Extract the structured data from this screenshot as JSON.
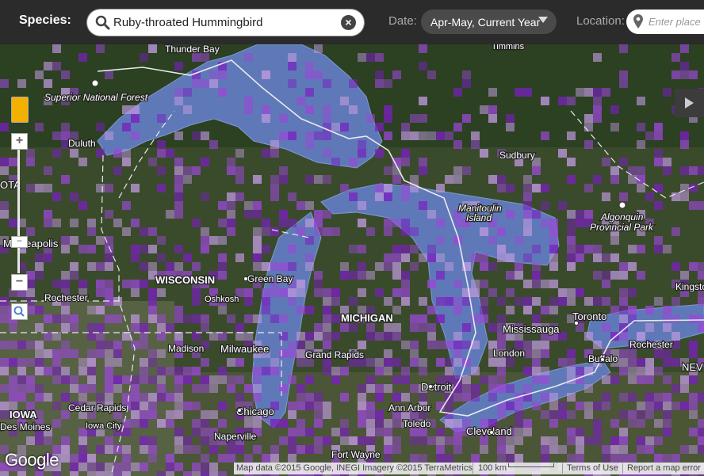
{
  "toolbar": {
    "species_label": "Species:",
    "species_value": "Ruby-throated Hummingbird",
    "date_label": "Date:",
    "date_value": "Apr-May, Current Year",
    "location_label": "Location:",
    "location_placeholder": "Enter place",
    "icons": [
      "search-icon",
      "clear-icon",
      "chevron-down-icon",
      "map-pin-icon"
    ]
  },
  "map": {
    "colors": {
      "land": "#3d4d2d",
      "lake": "#5f79b8",
      "occurrence_dark": "#7a1fc0",
      "occurrence_mid": "#9a48d6",
      "occurrence_light": "#c09ae0",
      "border": "#ffffff"
    },
    "labels": {
      "thunder_bay": "Thunder Bay",
      "superior_nf": "Superior National Forest",
      "duluth": "Duluth",
      "sudbury": "Sudbury",
      "manitoulin": "Manitoulin",
      "manitoulin2": "Island",
      "algonquin": "Algonquin",
      "algonquin2": "Provincial Park",
      "minneapolis": "Minneapolis",
      "wisconsin": "WISCONSIN",
      "green_bay": "Green Bay",
      "oshkosh": "Oshkosh",
      "rochester_mn": "Rochester",
      "michigan": "MICHIGAN",
      "madison": "Madison",
      "milwaukee": "Milwaukee",
      "grand_rapids": "Grand Rapids",
      "mississauga": "Mississauga",
      "toronto": "Toronto",
      "london": "London",
      "buffalo": "Buffalo",
      "rochester_ny": "Rochester",
      "kingston": "Kingsto",
      "ny": "NEV",
      "iowa": "IOWA",
      "cedar_rapids": "Cedar Rapids",
      "des_moines": "Des Moines",
      "iowa_city": "Iowa City",
      "chicago": "Chicago",
      "naperville": "Naperville",
      "detroit": "Detroit",
      "ann_arbor": "Ann Arbor",
      "toledo": "Toledo",
      "cleveland": "Cleveland",
      "fort_wayne": "Fort Wayne",
      "minnesota": "OTA",
      "timmins": "Timmins"
    },
    "controls": {
      "zoom_in": "+",
      "zoom_out": "−",
      "zoom_handle": "−"
    },
    "google_logo": "Google",
    "attribution": "Map data ©2015 Google, INEGI Imagery ©2015 TerraMetrics",
    "scale": "100 km",
    "terms": "Terms of Use",
    "report": "Report a map error"
  }
}
